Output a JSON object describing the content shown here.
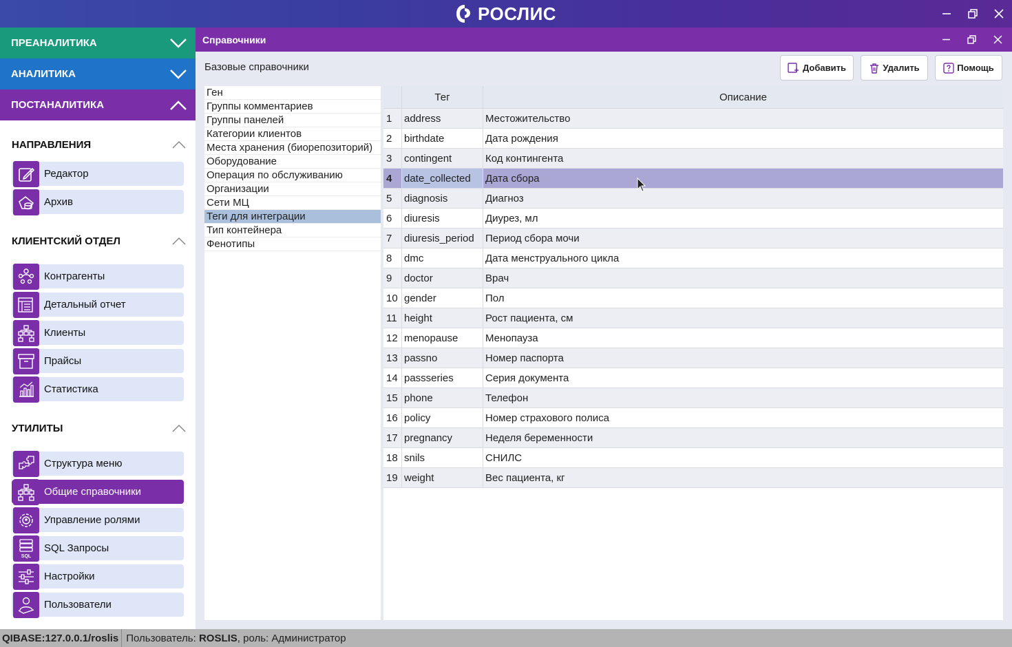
{
  "app": {
    "title": "РОСЛИС",
    "colors": {
      "primary": "#7a2ea8",
      "teal": "#1a9a7c",
      "blue": "#1f73c8"
    }
  },
  "sidebar": {
    "accordions": [
      {
        "label": "ПРЕАНАЛИТИКА",
        "state": "collapsed"
      },
      {
        "label": "АНАЛИТИКА",
        "state": "collapsed"
      },
      {
        "label": "ПОСТАНАЛИТИКА",
        "state": "expanded"
      }
    ],
    "sections": [
      {
        "title": "НАПРАВЛЕНИЯ",
        "items": [
          {
            "label": "Редактор",
            "icon": "edit-icon"
          },
          {
            "label": "Архив",
            "icon": "archive-icon"
          }
        ]
      },
      {
        "title": "КЛИЕНТСКИЙ ОТДЕЛ",
        "items": [
          {
            "label": "Контрагенты",
            "icon": "contractors-icon"
          },
          {
            "label": "Детальный отчет",
            "icon": "report-icon"
          },
          {
            "label": "Клиенты",
            "icon": "clients-icon"
          },
          {
            "label": "Прайсы",
            "icon": "prices-icon"
          },
          {
            "label": "Статистика",
            "icon": "statistics-icon"
          }
        ]
      },
      {
        "title": "УТИЛИТЫ",
        "items": [
          {
            "label": "Структура меню",
            "icon": "puzzle-icon"
          },
          {
            "label": "Общие справочники",
            "icon": "hierarchy-icon",
            "active": true
          },
          {
            "label": "Управление ролями",
            "icon": "roles-gear-icon"
          },
          {
            "label": "SQL Запросы",
            "icon": "sql-icon",
            "icon_text": "SQL"
          },
          {
            "label": "Настройки",
            "icon": "sliders-icon"
          },
          {
            "label": "Пользователи",
            "icon": "user-icon"
          }
        ]
      }
    ]
  },
  "panel": {
    "title": "Справочники",
    "subtitle": "Базовые справочники",
    "buttons": {
      "add": "Добавить",
      "delete": "Удалить",
      "help": "Помощь"
    }
  },
  "dictionaries": [
    "Ген",
    "Группы комментариев",
    "Группы панелей",
    "Категории клиентов",
    "Места хранения (биорепозиторий)",
    "Оборудование",
    "Операция по обслуживанию",
    "Организации",
    "Сети МЦ",
    "Теги для интеграции",
    "Тип контейнера",
    "Фенотипы"
  ],
  "selected_dictionary": "Теги для интеграции",
  "table": {
    "columns": [
      "Тег",
      "Описание"
    ],
    "rows": [
      {
        "n": "1",
        "tag": "address",
        "desc": "Местожительство"
      },
      {
        "n": "2",
        "tag": "birthdate",
        "desc": "Дата рождения"
      },
      {
        "n": "3",
        "tag": "contingent",
        "desc": "Код контингента"
      },
      {
        "n": "4",
        "tag": "date_collected",
        "desc": "Дата сбора",
        "selected": true
      },
      {
        "n": "5",
        "tag": "diagnosis",
        "desc": "Диагноз"
      },
      {
        "n": "6",
        "tag": "diuresis",
        "desc": "Диурез, мл"
      },
      {
        "n": "7",
        "tag": "diuresis_period",
        "desc": "Период сбора мочи"
      },
      {
        "n": "8",
        "tag": "dmc",
        "desc": "Дата менструального цикла"
      },
      {
        "n": "9",
        "tag": "doctor",
        "desc": "Врач"
      },
      {
        "n": "10",
        "tag": "gender",
        "desc": "Пол"
      },
      {
        "n": "11",
        "tag": "height",
        "desc": "Рост пациента, см"
      },
      {
        "n": "12",
        "tag": "menopause",
        "desc": "Менопауза"
      },
      {
        "n": "13",
        "tag": "passno",
        "desc": "Номер паспорта"
      },
      {
        "n": "14",
        "tag": "passseries",
        "desc": "Серия документа"
      },
      {
        "n": "15",
        "tag": "phone",
        "desc": "Телефон"
      },
      {
        "n": "16",
        "tag": "policy",
        "desc": "Номер страхового полиса"
      },
      {
        "n": "17",
        "tag": "pregnancy",
        "desc": "Неделя беременности"
      },
      {
        "n": "18",
        "tag": "snils",
        "desc": "СНИЛС"
      },
      {
        "n": "19",
        "tag": "weight",
        "desc": "Вес пациента, кг"
      }
    ]
  },
  "status": {
    "db": "QIBASE:127.0.0.1/roslis",
    "user_prefix": "Пользователь: ",
    "user": "ROSLIS",
    "role_text": ", роль: Администратор"
  }
}
